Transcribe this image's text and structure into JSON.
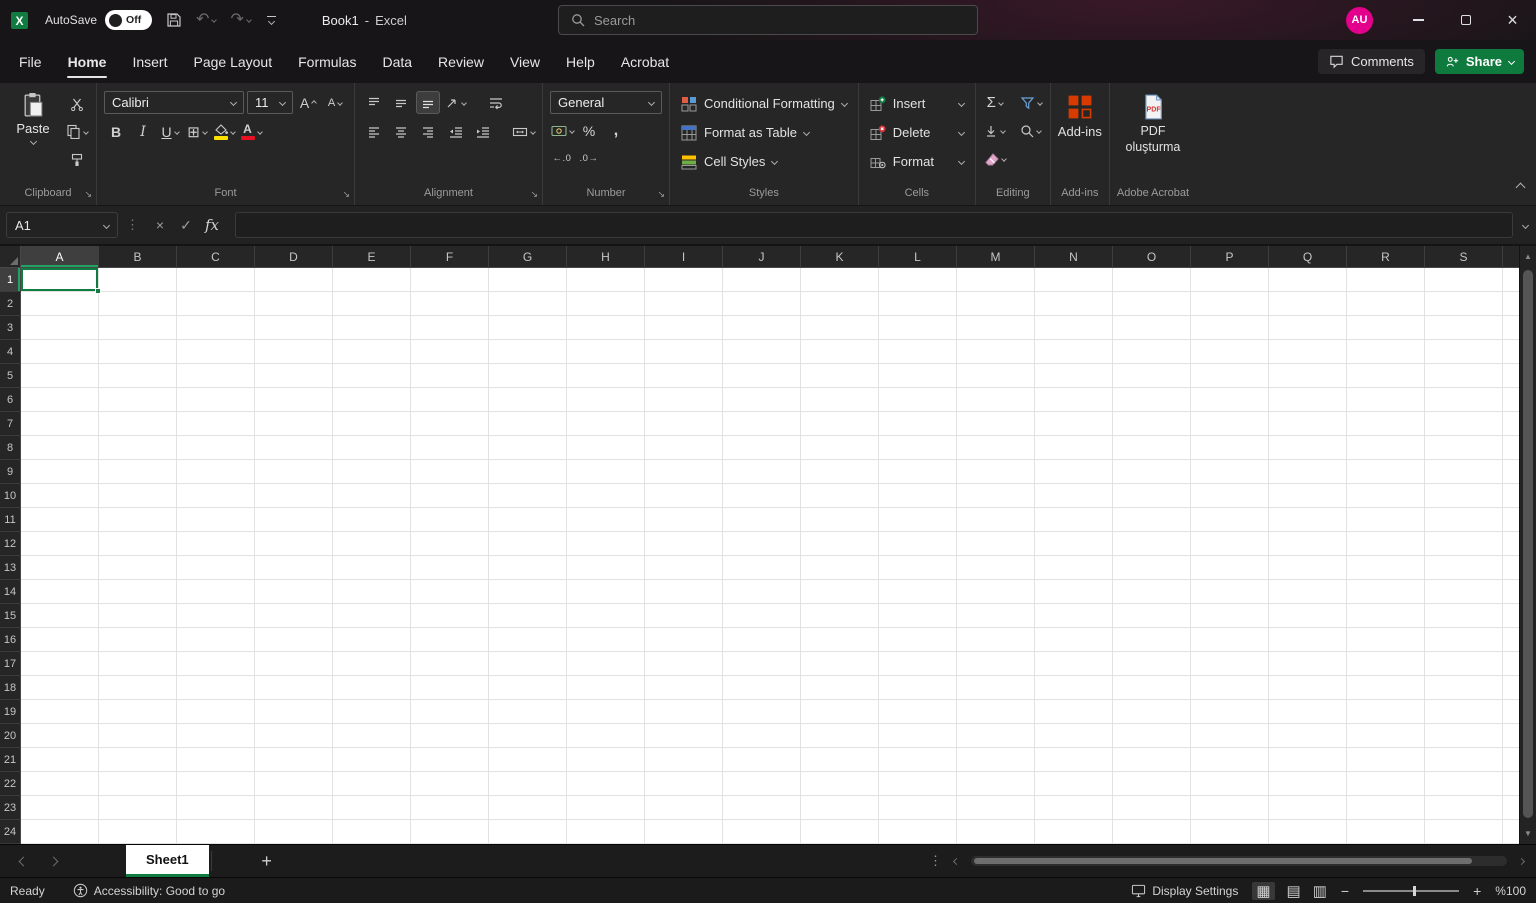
{
  "colors": {
    "accent_green": "#107c41",
    "selection_green": "#21a366",
    "avatar_pink": "#e3008c",
    "fill_yellow": "#ffe100",
    "font_red": "#e81123",
    "addins_orange": "#d83b01"
  },
  "titlebar": {
    "autosave_label": "AutoSave",
    "autosave_state": "Off",
    "doc_title": "Book1",
    "title_sep": "-",
    "app_name": "Excel",
    "search_placeholder": "Search",
    "avatar_initials": "AU"
  },
  "menubar": {
    "tabs": [
      "File",
      "Home",
      "Insert",
      "Page Layout",
      "Formulas",
      "Data",
      "Review",
      "View",
      "Help",
      "Acrobat"
    ],
    "active_tab": "Home",
    "comments_label": "Comments",
    "share_label": "Share"
  },
  "ribbon": {
    "clipboard": {
      "paste": "Paste",
      "group": "Clipboard"
    },
    "font": {
      "family": "Calibri",
      "size": "11",
      "group": "Font"
    },
    "alignment": {
      "group": "Alignment"
    },
    "number": {
      "format": "General",
      "group": "Number"
    },
    "styles": {
      "conditional_formatting": "Conditional Formatting",
      "format_as_table": "Format as Table",
      "cell_styles": "Cell Styles",
      "group": "Styles"
    },
    "cells": {
      "insert": "Insert",
      "delete": "Delete",
      "format": "Format",
      "group": "Cells"
    },
    "editing": {
      "group": "Editing"
    },
    "addins": {
      "label": "Add-ins",
      "group": "Add-ins"
    },
    "acrobat": {
      "label": "PDF oluşturma",
      "group": "Adobe Acrobat"
    }
  },
  "icons": {
    "bold": "B",
    "italic": "I",
    "underline": "U",
    "borders": "⊞",
    "sigma": "Σ",
    "percent": "%",
    "comma": ",",
    "decimal_increase": "←.0",
    "decimal_decrease": ".0→",
    "cancel": "×",
    "enter": "✓",
    "fx": "fx",
    "kebab": "⋮",
    "view_normal": "▦",
    "view_page_layout": "▤",
    "view_page_break": "▥",
    "zoom_out": "−",
    "zoom_in": "+",
    "add_sheet": "+"
  },
  "formula_bar": {
    "name_box": "A1",
    "value": ""
  },
  "grid": {
    "selected_cell": "A1",
    "columns": [
      "A",
      "B",
      "C",
      "D",
      "E",
      "F",
      "G",
      "H",
      "I",
      "J",
      "K",
      "L",
      "M",
      "N",
      "O",
      "P",
      "Q",
      "R",
      "S"
    ],
    "row_count": 24
  },
  "sheet_bar": {
    "tabs": [
      {
        "label": "Sheet1",
        "active": true
      }
    ]
  },
  "status_bar": {
    "mode": "Ready",
    "accessibility": "Accessibility: Good to go",
    "display_settings": "Display Settings",
    "zoom_level": "%100"
  }
}
